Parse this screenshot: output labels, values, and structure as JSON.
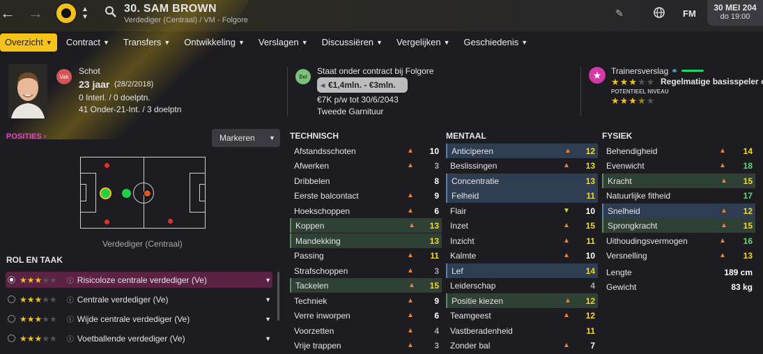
{
  "header": {
    "player_title": "30. SAM BROWN",
    "subtitle": "Verdediger (Centraal) / VM - Folgore",
    "fm_label": "FM",
    "date_line1": "30 MEI 204",
    "date_line2": "do 19:00"
  },
  "tabs": [
    {
      "label": "Overzicht",
      "active": true
    },
    {
      "label": "Contract"
    },
    {
      "label": "Transfers"
    },
    {
      "label": "Ontwikkeling"
    },
    {
      "label": "Verslagen"
    },
    {
      "label": "Discussiëren"
    },
    {
      "label": "Vergelijken"
    },
    {
      "label": "Geschiedenis"
    }
  ],
  "info": {
    "vak_badge": "Vak",
    "school_label": "Schot",
    "age": "23 jaar",
    "birthdate": "(28/2/2018)",
    "caps": "0 Interl. / 0 doelptn.",
    "u21": "41 Onder-21-Int. / 3 doelptn",
    "bel_badge": "Bel",
    "contract_label": "Staat onder contract bij Folgore",
    "value": "€1,4mln. - €3mln.",
    "wage": "€7K p/w tot 30/6/2043",
    "squad_status": "Tweede Garnituur",
    "coach_report_label": "Trainersverslag",
    "coach_report_text": "Regelmatige basisspeler o",
    "potential_label": "POTENTIEEL NIVEAU",
    "current_stars": 3,
    "potential_stars": 3.5
  },
  "positions": {
    "heading": "POSITIES",
    "mark_button": "Markeren",
    "position_name": "Verdediger (Centraal)"
  },
  "roles": {
    "heading": "ROL EN TAAK",
    "items": [
      {
        "label": "Risicoloze centrale verdediger (Ve)",
        "stars": 3,
        "selected": true
      },
      {
        "label": "Centrale verdediger (Ve)",
        "stars": 3
      },
      {
        "label": "Wijde centrale verdediger (Ve)",
        "stars": 3
      },
      {
        "label": "Voetballende verdediger (Ve)",
        "stars": 3
      }
    ]
  },
  "technical": {
    "heading": "TECHNISCH",
    "attrs": [
      {
        "name": "Afstandsschoten",
        "value": "10"
      },
      {
        "name": "Afwerken",
        "value": "3"
      },
      {
        "name": "Dribbelen",
        "value": "8"
      },
      {
        "name": "Eerste balcontact",
        "value": "9"
      },
      {
        "name": "Hoekschoppen",
        "value": "6"
      },
      {
        "name": "Koppen",
        "value": "13"
      },
      {
        "name": "Mandekking",
        "value": "13"
      },
      {
        "name": "Passing",
        "value": "11"
      },
      {
        "name": "Strafschoppen",
        "value": "3"
      },
      {
        "name": "Tackelen",
        "value": "15"
      },
      {
        "name": "Techniek",
        "value": "9"
      },
      {
        "name": "Verre inworpen",
        "value": "6"
      },
      {
        "name": "Voorzetten",
        "value": "4"
      },
      {
        "name": "Vrije trappen",
        "value": "3"
      }
    ]
  },
  "mental": {
    "heading": "MENTAAL",
    "attrs": [
      {
        "name": "Anticiperen",
        "value": "12"
      },
      {
        "name": "Beslissingen",
        "value": "13"
      },
      {
        "name": "Concentratie",
        "value": "13"
      },
      {
        "name": "Felheid",
        "value": "11"
      },
      {
        "name": "Flair",
        "value": "10"
      },
      {
        "name": "Inzet",
        "value": "15"
      },
      {
        "name": "Inzicht",
        "value": "11"
      },
      {
        "name": "Kalmte",
        "value": "10"
      },
      {
        "name": "Lef",
        "value": "14"
      },
      {
        "name": "Leiderschap",
        "value": "4"
      },
      {
        "name": "Positie kiezen",
        "value": "12"
      },
      {
        "name": "Teamgeest",
        "value": "12"
      },
      {
        "name": "Vastberadenheid",
        "value": "11"
      },
      {
        "name": "Zonder bal",
        "value": "7"
      }
    ]
  },
  "physical": {
    "heading": "FYSIEK",
    "attrs": [
      {
        "name": "Behendigheid",
        "value": "14"
      },
      {
        "name": "Evenwicht",
        "value": "18"
      },
      {
        "name": "Kracht",
        "value": "15"
      },
      {
        "name": "Natuurlijke fitheid",
        "value": "17"
      },
      {
        "name": "Snelheid",
        "value": "12"
      },
      {
        "name": "Sprongkracht",
        "value": "15"
      },
      {
        "name": "Uithoudingsvermogen",
        "value": "16"
      },
      {
        "name": "Versnelling",
        "value": "13"
      }
    ],
    "height_label": "Lengte",
    "height_value": "189 cm",
    "weight_label": "Gewicht",
    "weight_value": "83 kg"
  }
}
